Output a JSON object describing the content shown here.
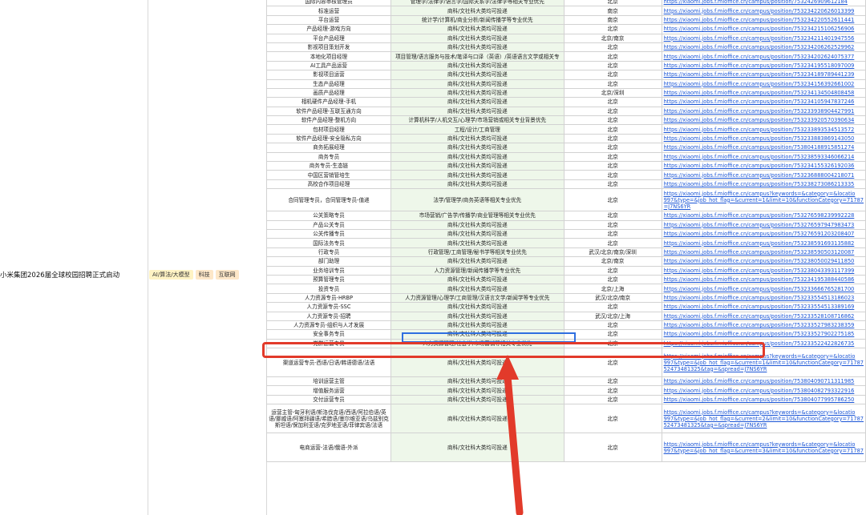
{
  "company": "小米集团2026届全球校园招聘正式启动",
  "tags": [
    "AI/算法/大模型",
    "科技",
    "互联网"
  ],
  "rows": [
    {
      "title": "国际内容审核管理员",
      "major": "管理学/法律学/语言学/国际关系学/法律学等相关专业优先",
      "city": "北京",
      "link": "https://xiaomi.jobs.f.mioffice.cn/campus/position/7532426909612184"
    },
    {
      "title": "标准运营",
      "major": "商科/文社科大类均可投递",
      "city": "南京",
      "link": "https://xiaomi.jobs.f.mioffice.cn/campus/position/753234220626013399"
    },
    {
      "title": "平台运营",
      "major": "统计学/计算机/商业分析/新闻传播学等专业优先",
      "city": "南京",
      "link": "https://xiaomi.jobs.f.mioffice.cn/campus/position/753234220552611441"
    },
    {
      "title": "产品经理-游戏方向",
      "major": "商科/文社科大类均可投递",
      "city": "北京",
      "link": "https://xiaomi.jobs.f.mioffice.cn/campus/position/753234215106256906"
    },
    {
      "title": "平台产品经理",
      "major": "商科/文社科大类均可投递",
      "city": "北京/南京",
      "link": "https://xiaomi.jobs.f.mioffice.cn/campus/position/753234211401947556"
    },
    {
      "title": "影视项目策划开发",
      "major": "商科/文社科大类均可投递",
      "city": "北京",
      "link": "https://xiaomi.jobs.f.mioffice.cn/campus/position/753234206262529962"
    },
    {
      "title": "本地化项目经理",
      "major": "项目管理/语言服务与技术/笔译与口译（英语）/英语语言文学或相关专",
      "city": "北京",
      "link": "https://xiaomi.jobs.f.mioffice.cn/campus/position/753234202624075377"
    },
    {
      "title": "AI工具产品运营",
      "major": "商科/文社科大类均可投递",
      "city": "北京",
      "link": "https://xiaomi.jobs.f.mioffice.cn/campus/position/753234195518097009"
    },
    {
      "title": "影视项目运营",
      "major": "商科/文社科大类均可投递",
      "city": "北京",
      "link": "https://xiaomi.jobs.f.mioffice.cn/campus/position/753234189789441239"
    },
    {
      "title": "生态产品经理",
      "major": "商科/文社科大类均可投递",
      "city": "北京",
      "link": "https://xiaomi.jobs.f.mioffice.cn/campus/position/753234156392661002"
    },
    {
      "title": "画质产品经理",
      "major": "商科/文社科大类均可投递",
      "city": "北京/深圳",
      "link": "https://xiaomi.jobs.f.mioffice.cn/campus/position/753234134504808458"
    },
    {
      "title": "相机硬件产品经理-手机",
      "major": "商科/文社科大类均可投递",
      "city": "北京",
      "link": "https://xiaomi.jobs.f.mioffice.cn/campus/position/753234105947837246"
    },
    {
      "title": "软件产品经理-互联互通方向",
      "major": "商科/文社科大类均可投递",
      "city": "北京",
      "link": "https://xiaomi.jobs.f.mioffice.cn/campus/position/753233938904427991"
    },
    {
      "title": "软件产品经理-整机方向",
      "major": "计算机科学/人机交互/心理学/市场营销或相关专业背景优先",
      "city": "北京",
      "link": "https://xiaomi.jobs.f.mioffice.cn/campus/position/753233920570390634"
    },
    {
      "title": "包材项目经理",
      "major": "工程/设计/工商管理",
      "city": "北京",
      "link": "https://xiaomi.jobs.f.mioffice.cn/campus/position/753233893534513572"
    },
    {
      "title": "软件产品经理-安全隐私方向",
      "major": "商科/文社科大类均可投递",
      "city": "北京",
      "link": "https://xiaomi.jobs.f.mioffice.cn/campus/position/753233883869143050"
    },
    {
      "title": "商务拓展经理",
      "major": "商科/文社科大类均可投递",
      "city": "北京",
      "link": "https://xiaomi.jobs.f.mioffice.cn/campus/position/753804188915851274"
    },
    {
      "title": "商务专员",
      "major": "商科/文社科大类均可投递",
      "city": "北京",
      "link": "https://xiaomi.jobs.f.mioffice.cn/campus/position/753238593346066214"
    },
    {
      "title": "商务专员-生态链",
      "major": "商科/文社科大类均可投递",
      "city": "北京",
      "link": "https://xiaomi.jobs.f.mioffice.cn/campus/position/753234155326192036"
    },
    {
      "title": "中国区营销管培生",
      "major": "商科/文社科大类均可投递",
      "city": "北京",
      "link": "https://xiaomi.jobs.f.mioffice.cn/campus/position/753236888004218071"
    },
    {
      "title": "高校合作项目经理",
      "major": "商科/文社科大类均可投递",
      "city": "北京",
      "link": "https://xiaomi.jobs.f.mioffice.cn/campus/position/753238273086213335"
    },
    {
      "title": "合同管理专员，合同管理专员-值递",
      "major": "法学/管理学/商务英语等相关专业优先",
      "city": "北京",
      "link": "https://xiaomi.jobs.f.mioffice.cn/campus?keywords=&category=&locatio 997&type=&job_hot_flag=&current=1&limit=10&functionCategory=71787 =J7NS6YR",
      "tall": 3
    },
    {
      "title": "公关策略专员",
      "major": "市场营销/广告学/传播学/商业管理等相关专业优先",
      "city": "北京",
      "link": "https://xiaomi.jobs.f.mioffice.cn/campus/position/753276598239992228"
    },
    {
      "title": "产品公关专员",
      "major": "商科/文社科大类均可投递",
      "city": "北京",
      "link": "https://xiaomi.jobs.f.mioffice.cn/campus/position/753276597947983473"
    },
    {
      "title": "公关传播专员",
      "major": "商科/文社科大类均可投递",
      "city": "北京",
      "link": "https://xiaomi.jobs.f.mioffice.cn/campus/position/753276591203208407"
    },
    {
      "title": "国际法务专员",
      "major": "商科/文社科大类均可投递",
      "city": "北京",
      "link": "https://xiaomi.jobs.f.mioffice.cn/campus/position/753238591693135882"
    },
    {
      "title": "行政专员",
      "major": "行政管理/工商管理/秘书学等相关专业优先",
      "city": "武汉/北京/南京/深圳",
      "link": "https://xiaomi.jobs.f.mioffice.cn/campus/position/753238590503120087"
    },
    {
      "title": "部门助理",
      "major": "商科/文社科大类均可投递",
      "city": "北京/南京",
      "link": "https://xiaomi.jobs.f.mioffice.cn/campus/position/753238050029411850"
    },
    {
      "title": "业务培训专员",
      "major": "人力资源管理/新闻传播学等专业优先",
      "city": "北京",
      "link": "https://xiaomi.jobs.f.mioffice.cn/campus/position/753238043393117399"
    },
    {
      "title": "预算管理专员",
      "major": "商科/文社科大类均可投递",
      "city": "北京",
      "link": "https://xiaomi.jobs.f.mioffice.cn/campus/position/753234195388440586"
    },
    {
      "title": "投资专员",
      "major": "商科/文社科大类均可投递",
      "city": "北京/上海",
      "link": "https://xiaomi.jobs.f.mioffice.cn/campus/position/753233666765281700"
    },
    {
      "title": "人力资源专员-HRBP",
      "major": "人力资源管理/心理学/工商管理/汉语言文学/新闻学等专业优先",
      "city": "武汉/北京/南京",
      "link": "https://xiaomi.jobs.f.mioffice.cn/campus/position/753233554513186023"
    },
    {
      "title": "人力资源专员-SSC",
      "major": "商科/文社科大类均可投递",
      "city": "北京",
      "link": "https://xiaomi.jobs.f.mioffice.cn/campus/position/753233554513389169"
    },
    {
      "title": "人力资源专员-招聘",
      "major": "商科/文社科大类均可投递",
      "city": "武汉/北京/上海",
      "link": "https://xiaomi.jobs.f.mioffice.cn/campus/position/753233528108716862"
    },
    {
      "title": "人力资源专员-组织与人才发展",
      "major": "商科/文社科大类均可投递",
      "city": "北京",
      "link": "https://xiaomi.jobs.f.mioffice.cn/campus/position/753233527983238359"
    },
    {
      "title": "安全事务专员",
      "major": "商科/文社科大类均可投递",
      "city": "北京",
      "link": "https://xiaomi.jobs.f.mioffice.cn/campus/position/753233527902275185"
    },
    {
      "title": "党群运营专员",
      "major": "人力资源管理/社会学/市场营销等相关专业优先",
      "city": "北京",
      "link": "https://xiaomi.jobs.f.mioffice.cn/campus/position/753233522422826735"
    },
    {
      "title": "渠道运营专员-西语/日语/韩语德语/法语",
      "major": "商科/文社科大类均可投递",
      "city": "北京",
      "link": "https://xiaomi.jobs.f.mioffice.cn/campus?keywords=&category=&locatio 997&type=&job_hot_flag=&current=1&limit=10&functionCategory=71787 52473481325&tag=&spread=J7NS6YR",
      "tall": 4
    },
    {
      "title": "培训运营主管",
      "major": "商科/文社科大类均可投递",
      "city": "北京",
      "link": "https://xiaomi.jobs.f.mioffice.cn/campus/position/753804090711311985"
    },
    {
      "title": "增值服务运营",
      "major": "商科/文社科大类均可投递",
      "city": "北京",
      "link": "https://xiaomi.jobs.f.mioffice.cn/campus/position/753804082793322916"
    },
    {
      "title": "交付运营专员",
      "major": "商科/文社科大类均可投递",
      "city": "北京",
      "link": "https://xiaomi.jobs.f.mioffice.cn/campus/position/753804077995786250"
    },
    {
      "title": "运营主管-匈牙利语/斯洛伐克语/西语/阿拉伯语/英语/挪威语/阿塞拜疆语/希腊语/塞尔维亚语/乌兹别克斯坦语/保加利亚语/克罗地亚语/菲律宾语/法语",
      "major": "商科/文社科大类均可投递",
      "city": "北京",
      "link": "https://xiaomi.jobs.f.mioffice.cn/campus?keywords=&category=&locatio 997&type=&job_hot_flag=&current=2&limit=10&functionCategory=71787 52473481325&tag=&spread=J7NS6YR",
      "tall": 4
    },
    {
      "title": "电商运营-法语/俄语-外派",
      "major": "商科/文社科大类均可投递",
      "city": "北京",
      "link": "https://xiaomi.jobs.f.mioffice.cn/campus?keywords=&category=&locatio 997&type=&job_hot_flag=&current=3&limit=10&functionCategory=71787",
      "tall": 4
    }
  ]
}
